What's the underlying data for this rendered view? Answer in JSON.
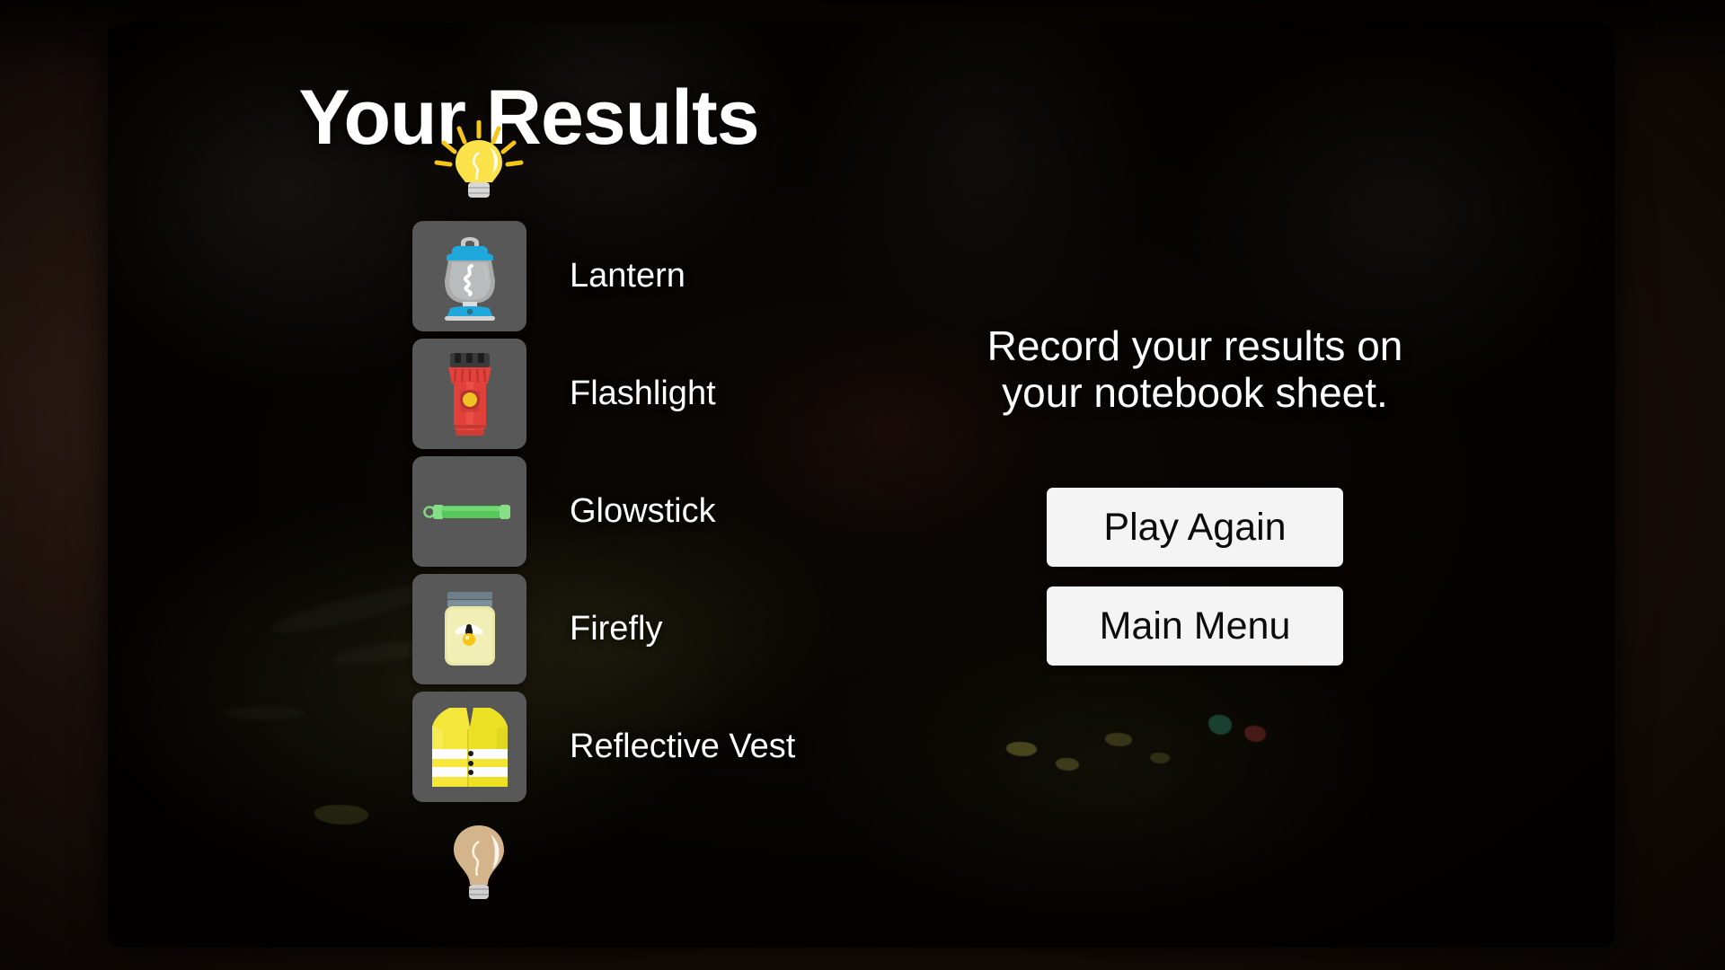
{
  "screen": {
    "title": "Your Results",
    "background_color": "#2b1a12",
    "panel_color": "#060301"
  },
  "ranking": {
    "top_indicator": {
      "icon": "bright-lightbulb-icon",
      "meaning": "Brightest"
    },
    "bottom_indicator": {
      "icon": "dim-lightbulb-icon",
      "meaning": "Dimmest"
    },
    "tile_color": "#585858",
    "items": [
      {
        "rank": 1,
        "label": "Lantern",
        "icon": "lantern-icon",
        "color": "#1fa8dc"
      },
      {
        "rank": 2,
        "label": "Flashlight",
        "icon": "flashlight-icon",
        "color": "#e23b34"
      },
      {
        "rank": 3,
        "label": "Glowstick",
        "icon": "glowstick-icon",
        "color": "#5cc95c"
      },
      {
        "rank": 4,
        "label": "Firefly",
        "icon": "firefly-jar-icon",
        "color": "#efeaa8"
      },
      {
        "rank": 5,
        "label": "Reflective Vest",
        "icon": "reflective-vest-icon",
        "color": "#f2e32a"
      }
    ]
  },
  "info": {
    "message": "Record your results on\nyour notebook sheet.",
    "buttons": [
      {
        "label": "Play Again",
        "name": "play-again-button"
      },
      {
        "label": "Main Menu",
        "name": "main-menu-button"
      }
    ]
  }
}
